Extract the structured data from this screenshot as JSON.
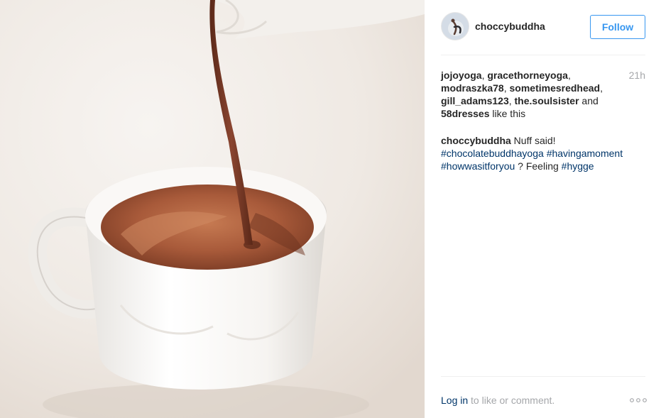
{
  "photo": {
    "alt_icon": "chocolate-pour-photo"
  },
  "header": {
    "username": "choccybuddha",
    "follow_label": "Follow"
  },
  "likes": {
    "users": [
      "jojoyoga",
      "gracethorneyoga",
      "modraszka78",
      "sometimesredhead",
      "gill_adams123",
      "the.soulsister"
    ],
    "sep": ", ",
    "and_word": " and ",
    "others": "58dresses",
    "suffix": " like this",
    "time": "21h"
  },
  "caption": {
    "username": "choccybuddha",
    "text": " Nuff said!",
    "hashtags": [
      "#chocolatebuddhayoga",
      "#havingamoment",
      "#howwasitforyou"
    ],
    "middle_text": " ? Feeling ",
    "last_hashtag": "#hygge"
  },
  "footer": {
    "login_label": "Log in",
    "rest_text": " to like or comment.",
    "more_icon": "more-options-icon"
  },
  "colors": {
    "accent": "#3897f0",
    "link": "#003569",
    "muted": "#a5a7aa",
    "text": "#262626"
  }
}
